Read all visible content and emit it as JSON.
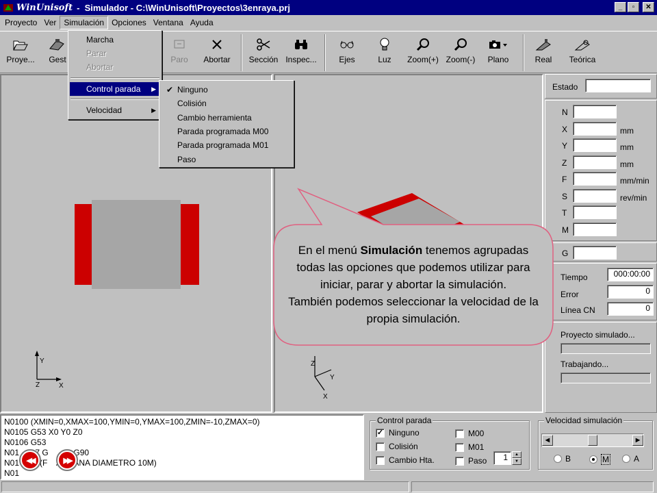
{
  "window": {
    "logo": "WinUnisoft",
    "title": "-  Simulador - C:\\WinUnisoft\\Proyectos\\3enraya.prj",
    "minimize": "_",
    "restore": "▫",
    "close": "✕"
  },
  "menubar": [
    "Proyecto",
    "Ver",
    "Simulación",
    "Opciones",
    "Ventana",
    "Ayuda"
  ],
  "toolbar": {
    "proyecto": "Proye...",
    "gestor": "Gest",
    "paro": "Paro",
    "abortar": "Abortar",
    "seccion": "Sección",
    "inspec": "Inspec...",
    "ejes": "Ejes",
    "luz": "Luz",
    "zoom_in": "Zoom(+)",
    "zoom_out": "Zoom(-)",
    "plano": "Plano",
    "real": "Real",
    "teorica": "Teórica"
  },
  "simulacion_menu": {
    "marcha": "Marcha",
    "parar": "Parar",
    "abortar": "Abortar",
    "control_parada": "Control parada",
    "velocidad": "Velocidad"
  },
  "control_parada_menu": {
    "items": [
      "Ninguno",
      "Colisión",
      "Cambio herramienta",
      "Parada programada M00",
      "Parada programada M01",
      "Paso"
    ],
    "checked": "✔"
  },
  "info": {
    "estado": "Estado",
    "axes": [
      {
        "label": "N",
        "unit": ""
      },
      {
        "label": "X",
        "unit": "mm"
      },
      {
        "label": "Y",
        "unit": "mm"
      },
      {
        "label": "Z",
        "unit": "mm"
      },
      {
        "label": "F",
        "unit": "mm/min"
      },
      {
        "label": "S",
        "unit": "rev/min"
      },
      {
        "label": "T",
        "unit": ""
      },
      {
        "label": "M",
        "unit": ""
      }
    ],
    "g": "G",
    "tiempo_label": "Tiempo",
    "tiempo": "000:00:00",
    "error_label": "Error",
    "error": "0",
    "linea_label": "Línea CN",
    "linea": "0",
    "proyecto_simulado": "Proyecto simulado...",
    "trabajando": "Trabajando..."
  },
  "code_lines": [
    "N0100 (XMIN=0,XMAX=100,YMIN=0,YMAX=100,ZMIN=-10,ZMAX=0)",
    "N0105 G53 X0 Y0 Z0",
    "N0106 G53",
    "N01     17 G      43 G90",
    "N01      1 (F    A PLANA DIAMETRO 10M)",
    "N01"
  ],
  "control_parada_group": {
    "title": "Control parada",
    "ninguno": "Ninguno",
    "colision": "Colisión",
    "cambio": "Cambio Hta.",
    "m00": "M00",
    "m01": "M01",
    "paso": "Paso",
    "paso_value": "1"
  },
  "velocidad_group": {
    "title": "Velocidad simulación",
    "b": "B",
    "m": "M",
    "a": "A",
    "selected": "M",
    "slider_fraction": 0.5
  },
  "axes_left": {
    "y": "Y",
    "z": "Z",
    "x": "X"
  },
  "axes_right": {
    "z": "Z",
    "y": "Y",
    "x": "X"
  },
  "callout": {
    "line1_pre": "En el menú ",
    "line1_bold": "Simulación",
    "line1_post": " tenemos agrupadas todas las opciones que podemos utilizar para iniciar, parar y abortar la simulación.",
    "line2": "También podemos seleccionar la velocidad de la propia simulación."
  },
  "colors": {
    "titlebar": "#000080",
    "workpiece_red": "#cc0000",
    "workpiece_grey": "#a6a6a6",
    "callout_border": "#e06080"
  }
}
